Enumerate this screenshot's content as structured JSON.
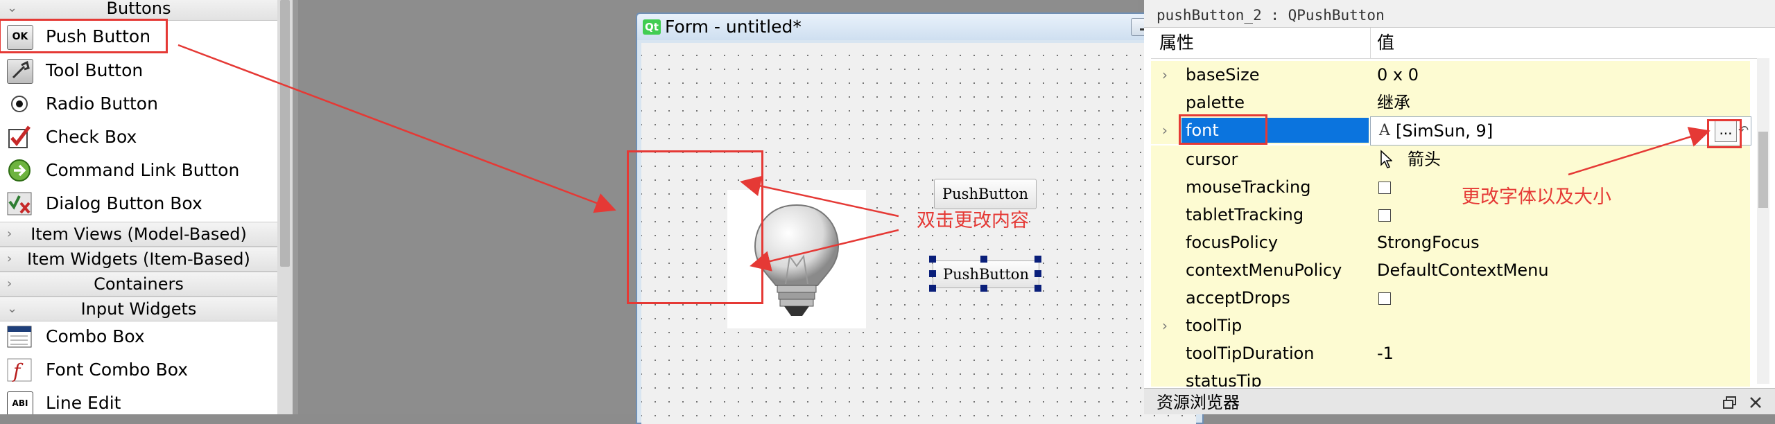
{
  "widget_box": {
    "categories": {
      "buttons": "Buttons",
      "item_views": "Item Views (Model-Based)",
      "item_widgets": "Item Widgets (Item-Based)",
      "containers": "Containers",
      "input_widgets": "Input Widgets"
    },
    "buttons": [
      "Push Button",
      "Tool Button",
      "Radio Button",
      "Check Box",
      "Command Link Button",
      "Dialog Button Box"
    ],
    "inputs": [
      "Combo Box",
      "Font Combo Box",
      "Line Edit"
    ],
    "icons": {
      "push_button": "OK",
      "line_edit": "ABI"
    }
  },
  "form": {
    "logo": "Qt",
    "title": "Form - untitled*",
    "close_glyph": "✕",
    "button1": "PushButton",
    "button2": "PushButton"
  },
  "annotations": {
    "double_click_note": "双击更改内容",
    "font_note": "更改字体以及大小",
    "color": "#e53935"
  },
  "property_editor": {
    "object_label": "pushButton_2 : QPushButton",
    "header_property": "属性",
    "header_value": "值",
    "rows": [
      {
        "name": "baseSize",
        "value": "0 x 0"
      },
      {
        "name": "palette",
        "value": "继承"
      },
      {
        "name": "font",
        "value": "[SimSun, 9]"
      },
      {
        "name": "cursor",
        "value": "箭头"
      },
      {
        "name": "mouseTracking",
        "value": ""
      },
      {
        "name": "tabletTracking",
        "value": ""
      },
      {
        "name": "focusPolicy",
        "value": "StrongFocus"
      },
      {
        "name": "contextMenuPolicy",
        "value": "DefaultContextMenu"
      },
      {
        "name": "acceptDrops",
        "value": ""
      },
      {
        "name": "toolTip",
        "value": ""
      },
      {
        "name": "toolTipDuration",
        "value": "-1"
      },
      {
        "name": "statusTip",
        "value": ""
      }
    ],
    "font_icon": "A",
    "ellipsis_button": "...",
    "reset_icon": "↶",
    "selection_color": "#0b74de"
  },
  "resource_browser": {
    "title": "资源浏览器"
  }
}
